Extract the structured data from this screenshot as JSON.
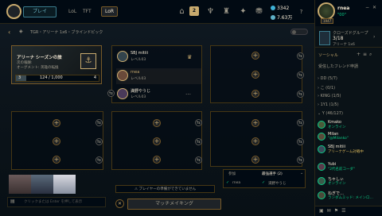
{
  "top": {
    "play_label": "プレイ",
    "tabs": [
      "LoL",
      "TFT",
      "LoR"
    ],
    "notification_count": "2",
    "rp": "3342",
    "be": "7.63万"
  },
  "profile": {
    "name": "rnea",
    "status": "\"00\"",
    "level": "1947"
  },
  "club": {
    "title": "クローズドグループ",
    "count": "3/18",
    "subtitle": "アリーナ 1x6"
  },
  "social": {
    "title": "ソーシャル",
    "received": "受信したフレンド申請"
  },
  "groups": [
    "DD (5/7)",
    "こ (0/1)",
    "KING (1/5)",
    "1Y1 (1/5)",
    "Y (46/127)"
  ],
  "friends": [
    {
      "name": "Kmako",
      "status": "オンライン"
    },
    {
      "name": "Milan",
      "status": "\"@Milanko\""
    },
    {
      "name": "SBJ mitiii",
      "status": "アリーナゲーム対戦中"
    },
    {
      "name": "Yubi",
      "status": "\"2代名前コーダ\""
    },
    {
      "name": "ちゃしぃ",
      "status": "オンライン"
    },
    {
      "name": "ねぎで…",
      "status": "ランダムミッド: メインロ…"
    }
  ],
  "lobby": {
    "breadcrumb": "TGR・アリーナ 1x6・ブラインドピック"
  },
  "pass": {
    "title": "アリーナ シーズンの旅",
    "sub": "次の報酬:",
    "reward": "オーグメント: 英雄の転換",
    "progress_text": "124 / 1,000",
    "level_left": "3",
    "level_right": "4",
    "progress": 0.124
  },
  "members": [
    {
      "name": "SBJ mitiii",
      "level": "レベル03"
    },
    {
      "name": "rnea",
      "level": "レベル03"
    },
    {
      "name": "満野やうじ",
      "level": "レベル03"
    }
  ],
  "chat": {
    "placeholder": "クリックまたは Enter を押して表示"
  },
  "notice": "プレイヤーの準備ができていません",
  "match_button": "マッチメイキング",
  "positions": {
    "header_left": "参加",
    "header_right": "最強選手 (2)",
    "p1": "rnea",
    "p2": "満野やうじ"
  },
  "colors": {
    "accent": "#c8aa6e",
    "online": "#0acb86",
    "panel": "#010a13"
  }
}
